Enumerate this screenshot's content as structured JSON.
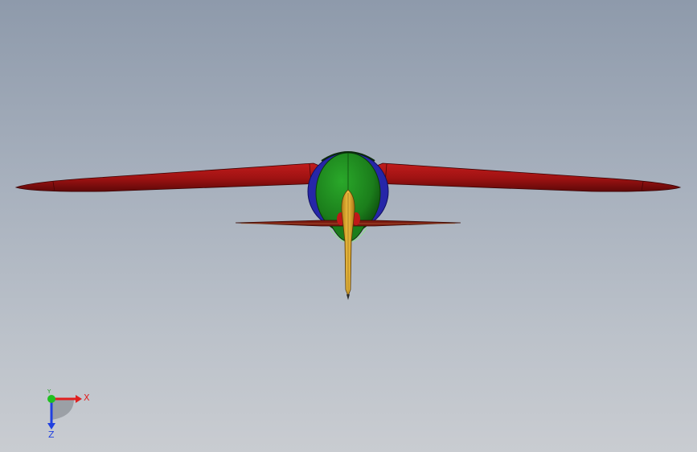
{
  "viewport": {
    "background_top": "#8e9aab",
    "background_bottom": "#c9ccd1"
  },
  "model": {
    "wing_color": "#a01515",
    "fuselage_color": "#1f8a1f",
    "tail_color": "#7a1a10",
    "ring_color": "#2a2ab0",
    "spine_color": "#e0b030"
  },
  "triad": {
    "x_label": "X",
    "y_label": "Y",
    "z_label": "Z",
    "x_color": "#e02020",
    "y_color": "#20c020",
    "z_color": "#2040e0"
  }
}
